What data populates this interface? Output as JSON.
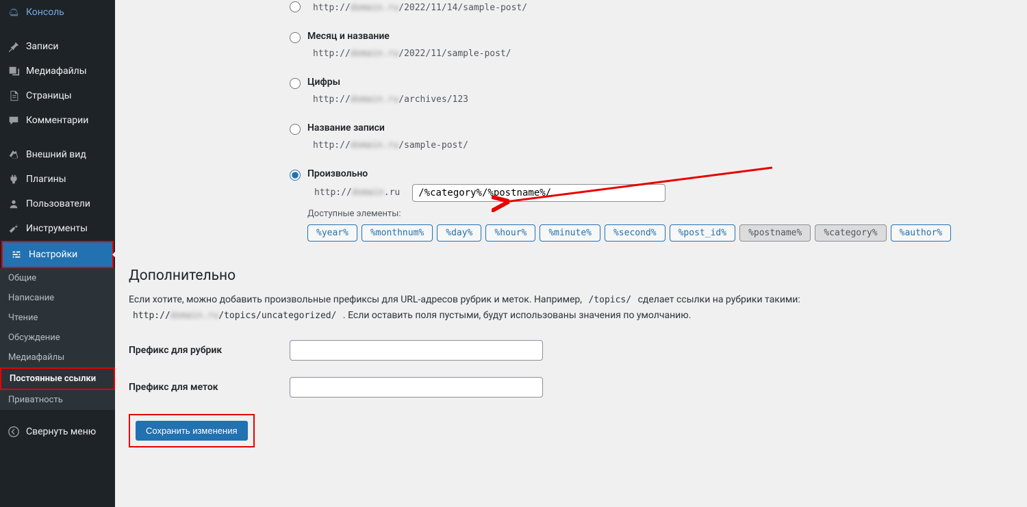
{
  "sidebar": {
    "items": [
      {
        "label": "Консоль",
        "icon": "dashboard"
      },
      {
        "label": "Записи",
        "icon": "pin"
      },
      {
        "label": "Медиафайлы",
        "icon": "media"
      },
      {
        "label": "Страницы",
        "icon": "pages"
      },
      {
        "label": "Комментарии",
        "icon": "comments"
      },
      {
        "label": "Внешний вид",
        "icon": "appearance"
      },
      {
        "label": "Плагины",
        "icon": "plugins"
      },
      {
        "label": "Пользователи",
        "icon": "users"
      },
      {
        "label": "Инструменты",
        "icon": "tools"
      },
      {
        "label": "Настройки",
        "icon": "settings"
      }
    ],
    "submenu": [
      {
        "label": "Общие"
      },
      {
        "label": "Написание"
      },
      {
        "label": "Чтение"
      },
      {
        "label": "Обсуждение"
      },
      {
        "label": "Медиафайлы"
      },
      {
        "label": "Постоянные ссылки"
      },
      {
        "label": "Приватность"
      }
    ],
    "collapse": "Свернуть меню"
  },
  "permalinks": {
    "options": [
      {
        "label": "",
        "url_prefix": "http://",
        "url_path": "/2022/11/14/sample-post/"
      },
      {
        "label": "Месяц и название",
        "url_prefix": "http://",
        "url_path": "/2022/11/sample-post/"
      },
      {
        "label": "Цифры",
        "url_prefix": "http://",
        "url_path": "/archives/123"
      },
      {
        "label": "Название записи",
        "url_prefix": "http://",
        "url_path": "/sample-post/"
      },
      {
        "label": "Произвольно",
        "url_prefix": "http://",
        "url_suffix": ".ru"
      }
    ],
    "custom_value": "/%category%/%postname%/",
    "available_label": "Доступные элементы:",
    "tags": [
      "%year%",
      "%monthnum%",
      "%day%",
      "%hour%",
      "%minute%",
      "%second%",
      "%post_id%",
      "%postname%",
      "%category%",
      "%author%"
    ],
    "selected_tags": [
      "%postname%",
      "%category%"
    ]
  },
  "extra": {
    "heading": "Дополнительно",
    "desc_pre": "Если хотите, можно добавить произвольные префиксы для URL-адресов рубрик и меток. Например, ",
    "desc_code1": "/topics/",
    "desc_mid": " сделает ссылки на рубрики такими: ",
    "desc_code2_prefix": "http://",
    "desc_code2_path": "/topics/uncategorized/",
    "desc_post": " . Если оставить поля пустыми, будут использованы значения по умолчанию.",
    "category_label": "Префикс для рубрик",
    "tag_label": "Префикс для меток"
  },
  "submit": "Сохранить изменения"
}
